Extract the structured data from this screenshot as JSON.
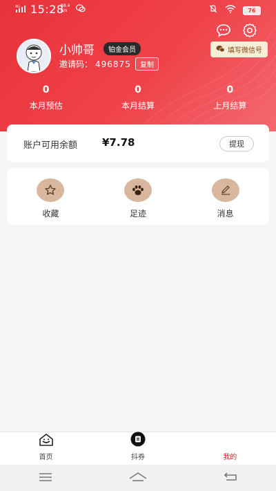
{
  "status_bar": {
    "signal": "4G",
    "time": "15:28",
    "speed_value": "88.4",
    "speed_unit": "B/s",
    "battery": "76"
  },
  "profile": {
    "username": "小帅哥",
    "vip_badge": "铂金会员",
    "invite_label": "邀请码：",
    "invite_code": "496875",
    "copy_label": "复制",
    "wechat_fill_label": "填写微信号"
  },
  "stats": [
    {
      "value": "0",
      "label": "本月预估"
    },
    {
      "value": "0",
      "label": "本月结算"
    },
    {
      "value": "0",
      "label": "上月结算"
    }
  ],
  "balance": {
    "label": "账户可用余额",
    "amount": "¥7.78",
    "withdraw_label": "提现"
  },
  "shortcuts": [
    {
      "label": "收藏",
      "icon": "star-icon"
    },
    {
      "label": "足迹",
      "icon": "paw-icon"
    },
    {
      "label": "消息",
      "icon": "pen-icon"
    }
  ],
  "tabbar": [
    {
      "label": "首页",
      "icon": "home-icon",
      "active": false
    },
    {
      "label": "抖券",
      "icon": "coupon-icon",
      "active": false
    },
    {
      "label": "我的",
      "icon": "",
      "active": true
    }
  ],
  "colors": {
    "brand_red": "#e8323a",
    "shortcut_bg": "#d8b79e",
    "active_tab": "#d7262e"
  }
}
